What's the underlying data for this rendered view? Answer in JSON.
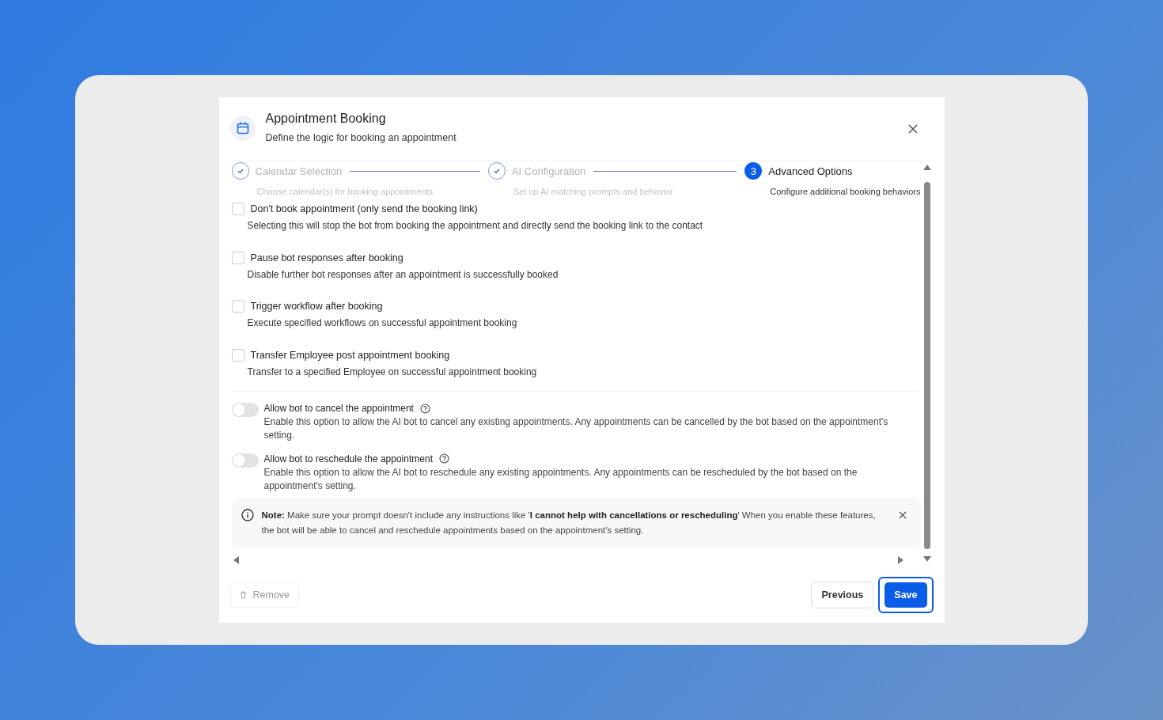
{
  "dialog": {
    "title": "Appointment Booking",
    "subtitle": "Define the logic for booking an appointment"
  },
  "steps": [
    {
      "label": "Calendar Selection",
      "description": "Choose calendar(s) for booking appointments",
      "completed": true
    },
    {
      "label": "AI Configuration",
      "description": "Set up AI matching prompts and behavior",
      "completed": true
    },
    {
      "number": "3",
      "label": "Advanced Options",
      "description": "Configure additional booking behaviors",
      "completed": false
    }
  ],
  "checkbox_options": [
    {
      "label": "Don't book appointment (only send the booking link)",
      "description": "Selecting this will stop the bot from booking the appointment and directly send the booking link to the contact",
      "checked": false
    },
    {
      "label": "Pause bot responses after booking",
      "description": "Disable further bot responses after an appointment is successfully booked",
      "checked": false
    },
    {
      "label": "Trigger workflow after booking",
      "description": "Execute specified workflows on successful appointment booking",
      "checked": false
    },
    {
      "label": "Transfer Employee post appointment booking",
      "description": "Transfer to a specified Employee on successful appointment booking",
      "checked": false
    }
  ],
  "toggle_options": [
    {
      "label": "Allow bot to cancel the appointment",
      "description": "Enable this option to allow the AI bot to cancel any existing appointments. Any appointments can be cancelled by the bot based on the appointment's setting.",
      "on": false
    },
    {
      "label": "Allow bot to reschedule the appointment",
      "description": "Enable this option to allow the AI bot to reschedule any existing appointments. Any appointments can be rescheduled by the bot based on the appointment's setting.",
      "on": false
    }
  ],
  "note": "**Note:** Make sure your prompt doesn't include any instructions like '**I cannot help with cancellations or rescheduling**' When you enable these features, the bot will be able to cancel and reschedule appointments based on the appointment's setting.",
  "footer": {
    "remove": "Remove",
    "previous": "Previous",
    "save": "Save"
  }
}
